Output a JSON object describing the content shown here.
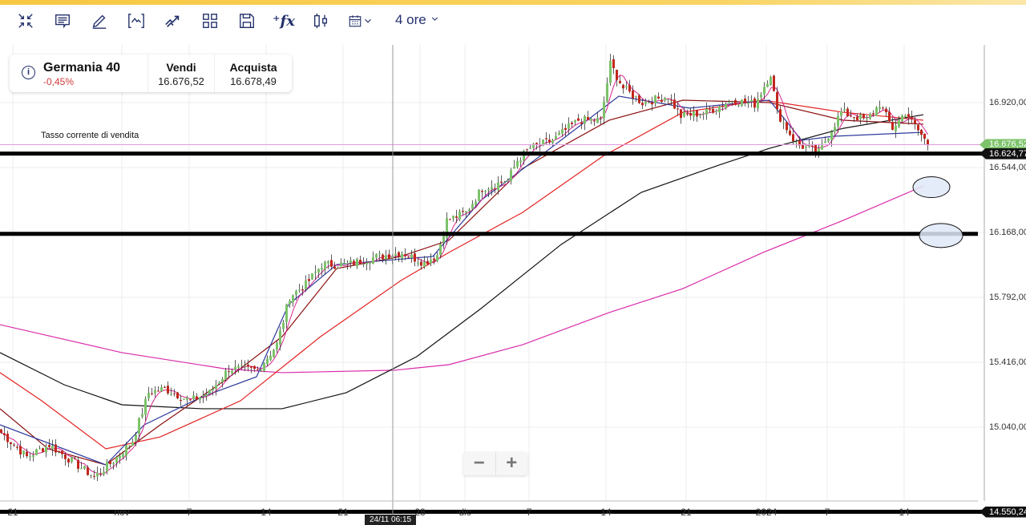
{
  "toolbar": {
    "icons": [
      "collapse-icon",
      "comment-icon",
      "pencil-icon",
      "indicator-bracket-icon",
      "trend-icon",
      "layout-grid-icon",
      "save-icon",
      "function-fx-icon",
      "candlestick-icon",
      "calendar-icon"
    ],
    "period": "4 ore"
  },
  "instrument": {
    "name": "Germania 40",
    "change": "-0,45%",
    "sell_label": "Vendi",
    "sell": "16.676,52",
    "buy_label": "Acquista",
    "buy": "16.678,49"
  },
  "annotation": "Tasso corrente di vendita",
  "zoom": {
    "minus": "−",
    "plus": "+"
  },
  "crosshair_label": "24/11 06:15",
  "colors": {
    "up": "#7cc36a",
    "down": "#c2271c",
    "ma5": "#d6278f",
    "ma10": "#2f3b9c",
    "ma20": "#8b1010",
    "ma50": "#e32222",
    "ma100": "#111111",
    "ma200": "#d92cab",
    "price_line": "#e49be0",
    "price_tag": "#7cc36a"
  },
  "chart_data": {
    "type": "candlestick",
    "title": "Germania 40",
    "timeframe": "4 ore",
    "y_ticks": [
      "16.920,00",
      "16.544,00",
      "16.168,00",
      "15.792,00",
      "15.416,00",
      "15.040,00"
    ],
    "y_tick_values": [
      16920,
      16544,
      16168,
      15792,
      15416,
      15040
    ],
    "ylim": [
      14520,
      17270
    ],
    "x_ticks": [
      {
        "label": "21",
        "bar": 4
      },
      {
        "label": "nov",
        "bar": 38
      },
      {
        "label": "7",
        "bar": 59
      },
      {
        "label": "14",
        "bar": 83
      },
      {
        "label": "21",
        "bar": 107
      },
      {
        "label": "28",
        "bar": 131
      },
      {
        "label": "dic",
        "bar": 145
      },
      {
        "label": "7",
        "bar": 165
      },
      {
        "label": "14",
        "bar": 189
      },
      {
        "label": "21",
        "bar": 214
      },
      {
        "label": "2024",
        "bar": 239
      },
      {
        "label": "7",
        "bar": 258
      },
      {
        "label": "14",
        "bar": 282
      }
    ],
    "bars": 290,
    "close_keyframes": [
      [
        0,
        15008
      ],
      [
        8,
        14868
      ],
      [
        15,
        14938
      ],
      [
        22,
        14845
      ],
      [
        29,
        14752
      ],
      [
        35,
        14845
      ],
      [
        41,
        14961
      ],
      [
        46,
        15240
      ],
      [
        51,
        15263
      ],
      [
        59,
        15193
      ],
      [
        65,
        15240
      ],
      [
        71,
        15379
      ],
      [
        80,
        15370
      ],
      [
        86,
        15518
      ],
      [
        90,
        15797
      ],
      [
        95,
        15866
      ],
      [
        100,
        15982
      ],
      [
        108,
        15982
      ],
      [
        115,
        16019
      ],
      [
        125,
        16052
      ],
      [
        132,
        15992
      ],
      [
        136,
        16038
      ],
      [
        139,
        16238
      ],
      [
        145,
        16284
      ],
      [
        150,
        16423
      ],
      [
        158,
        16470
      ],
      [
        161,
        16586
      ],
      [
        165,
        16655
      ],
      [
        172,
        16702
      ],
      [
        180,
        16818
      ],
      [
        187,
        16818
      ],
      [
        190,
        17143
      ],
      [
        194,
        17004
      ],
      [
        200,
        16920
      ],
      [
        208,
        16957
      ],
      [
        212,
        16841
      ],
      [
        220,
        16864
      ],
      [
        228,
        16934
      ],
      [
        235,
        16911
      ],
      [
        240,
        17087
      ],
      [
        242,
        16864
      ],
      [
        248,
        16679
      ],
      [
        255,
        16632
      ],
      [
        262,
        16864
      ],
      [
        270,
        16818
      ],
      [
        274,
        16911
      ],
      [
        278,
        16771
      ],
      [
        282,
        16864
      ],
      [
        289,
        16679
      ]
    ],
    "moving_averages": [
      {
        "name": "MA200",
        "color": "#d92cab",
        "points": [
          [
            0,
            15634
          ],
          [
            38,
            15472
          ],
          [
            70,
            15379
          ],
          [
            88,
            15356
          ],
          [
            123,
            15370
          ],
          [
            140,
            15402
          ],
          [
            163,
            15518
          ],
          [
            190,
            15704
          ],
          [
            213,
            15843
          ],
          [
            238,
            16052
          ],
          [
            263,
            16238
          ],
          [
            288,
            16437
          ]
        ]
      },
      {
        "name": "MA100",
        "color": "#111111",
        "points": [
          [
            0,
            15472
          ],
          [
            20,
            15286
          ],
          [
            38,
            15170
          ],
          [
            63,
            15147
          ],
          [
            88,
            15147
          ],
          [
            108,
            15240
          ],
          [
            130,
            15449
          ],
          [
            150,
            15727
          ],
          [
            175,
            16098
          ],
          [
            200,
            16400
          ],
          [
            225,
            16563
          ],
          [
            240,
            16655
          ],
          [
            263,
            16771
          ],
          [
            288,
            16850
          ]
        ]
      },
      {
        "name": "MA50",
        "color": "#e32222",
        "points": [
          [
            0,
            15356
          ],
          [
            13,
            15193
          ],
          [
            33,
            14915
          ],
          [
            50,
            14984
          ],
          [
            75,
            15193
          ],
          [
            100,
            15565
          ],
          [
            125,
            15889
          ],
          [
            140,
            16052
          ],
          [
            163,
            16284
          ],
          [
            188,
            16609
          ],
          [
            213,
            16864
          ],
          [
            238,
            16934
          ],
          [
            263,
            16864
          ],
          [
            288,
            16818
          ]
        ]
      },
      {
        "name": "MA20",
        "color": "#8b1010",
        "points": [
          [
            0,
            15147
          ],
          [
            15,
            14915
          ],
          [
            33,
            14822
          ],
          [
            50,
            15054
          ],
          [
            70,
            15309
          ],
          [
            88,
            15565
          ],
          [
            105,
            15959
          ],
          [
            125,
            16029
          ],
          [
            140,
            16122
          ],
          [
            163,
            16539
          ],
          [
            190,
            16818
          ],
          [
            213,
            16934
          ],
          [
            240,
            16920
          ],
          [
            263,
            16818
          ],
          [
            288,
            16795
          ]
        ]
      },
      {
        "name": "MA10",
        "color": "#2f3b9c",
        "points": [
          [
            0,
            15054
          ],
          [
            33,
            14822
          ],
          [
            45,
            15054
          ],
          [
            63,
            15216
          ],
          [
            80,
            15332
          ],
          [
            90,
            15750
          ],
          [
            105,
            15982
          ],
          [
            135,
            16029
          ],
          [
            150,
            16354
          ],
          [
            170,
            16632
          ],
          [
            193,
            16957
          ],
          [
            215,
            16888
          ],
          [
            240,
            16934
          ],
          [
            250,
            16702
          ],
          [
            260,
            16725
          ],
          [
            288,
            16748
          ]
        ]
      }
    ],
    "horizontal_lines": [
      {
        "price": 16624.77,
        "label": "16.624,77",
        "color": "#000000"
      },
      {
        "price": 16160,
        "label": "",
        "color": "#000000"
      },
      {
        "price": 14550.24,
        "label": "14.550,24",
        "color": "#000000"
      }
    ],
    "current_price": {
      "price": 16676.52,
      "label": "16.676,52"
    },
    "highlight_ellipses": [
      {
        "bar": 291,
        "price": 16430
      },
      {
        "bar": 294,
        "price": 16150
      }
    ],
    "crosshair_bar": 122
  }
}
